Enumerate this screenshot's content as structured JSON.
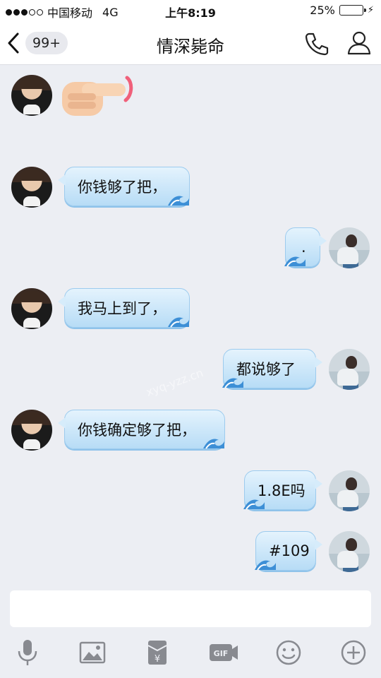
{
  "status_bar": {
    "carrier": "中国移动",
    "network": "4G",
    "time": "上午8:19",
    "battery": "25%",
    "battery_level": 0.25
  },
  "header": {
    "unread_count": "99+",
    "title": "情深毙命"
  },
  "messages": [
    {
      "side": "left",
      "type": "emoji",
      "icon": "pointing-hand-emoji"
    },
    {
      "side": "left",
      "type": "text",
      "text": "你钱够了把，"
    },
    {
      "side": "right",
      "type": "text",
      "text": "."
    },
    {
      "side": "left",
      "type": "text",
      "text": "我马上到了，"
    },
    {
      "side": "right",
      "type": "text",
      "text": "都说够了"
    },
    {
      "side": "left",
      "type": "text",
      "text": "你钱确定够了把，"
    },
    {
      "side": "right",
      "type": "text",
      "text": "1.8E吗"
    },
    {
      "side": "right",
      "type": "text",
      "text": "#109"
    }
  ],
  "watermark": "xyq-yzz.cn",
  "input": {
    "value": "",
    "placeholder": ""
  },
  "toolbar": [
    "microphone-icon",
    "image-icon",
    "red-packet-icon",
    "gif-icon",
    "emoji-icon",
    "plus-icon"
  ],
  "colors": {
    "bubble": "#cfe9fb",
    "background": "#eceef3",
    "icon": "#888a90"
  }
}
